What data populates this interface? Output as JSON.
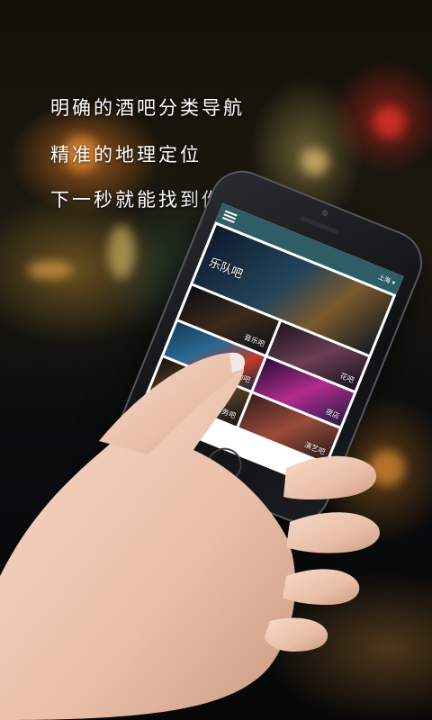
{
  "slogans": {
    "line1": "明确的酒吧分类导航",
    "line2": "精准的地理定位",
    "line3": "下一秒就能找到你想要的"
  },
  "app": {
    "city_selector": "上海 ▾",
    "tiles": [
      {
        "label": "乐队吧"
      },
      {
        "label": "音乐吧"
      },
      {
        "label": "花吧"
      },
      {
        "label": "运动吧"
      },
      {
        "label": "夜店"
      },
      {
        "label": "商务吧"
      },
      {
        "label": "演艺吧"
      }
    ]
  },
  "icons": [
    "menu-icon"
  ]
}
